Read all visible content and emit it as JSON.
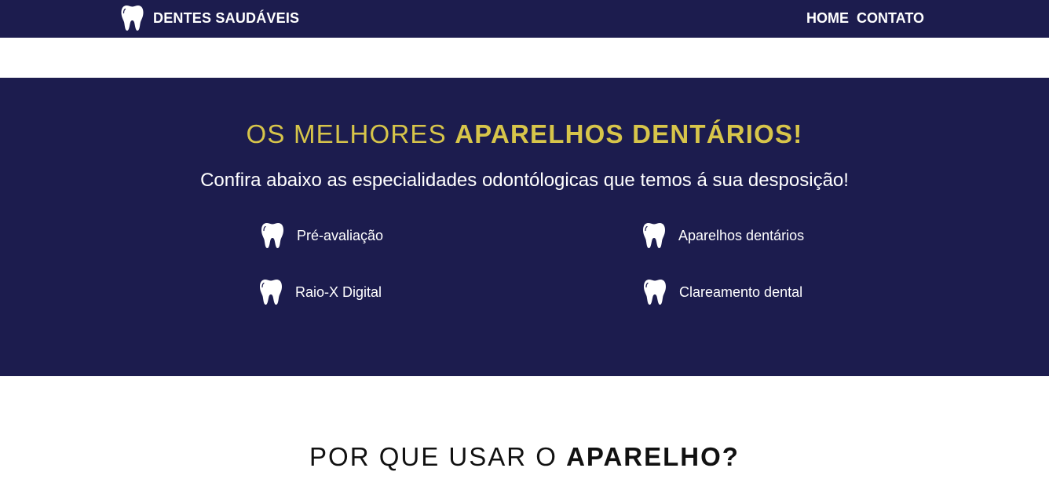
{
  "navbar": {
    "brand_icon": "tooth-icon",
    "brand_label": "DENTES SAUDÁVEIS",
    "links": [
      {
        "label": "HOME"
      },
      {
        "label": "CONTATO"
      }
    ]
  },
  "hero": {
    "title_light": "OS MELHORES",
    "title_strong": "APARELHOS DENTÁRIOS!",
    "subtitle": "Confira abaixo as especialidades odontólogicas que temos á sua desposição!",
    "services": [
      {
        "icon": "tooth-icon",
        "label": "Pré-avaliação"
      },
      {
        "icon": "tooth-icon",
        "label": "Aparelhos dentários"
      },
      {
        "icon": "tooth-icon",
        "label": "Raio-X Digital"
      },
      {
        "icon": "tooth-icon",
        "label": "Clareamento dental"
      }
    ]
  },
  "section": {
    "title_light": "POR QUE USAR O",
    "title_strong": "APARELHO?"
  },
  "colors": {
    "navy": "#1c1c4e",
    "gold": "#d7c54a",
    "white": "#ffffff"
  }
}
